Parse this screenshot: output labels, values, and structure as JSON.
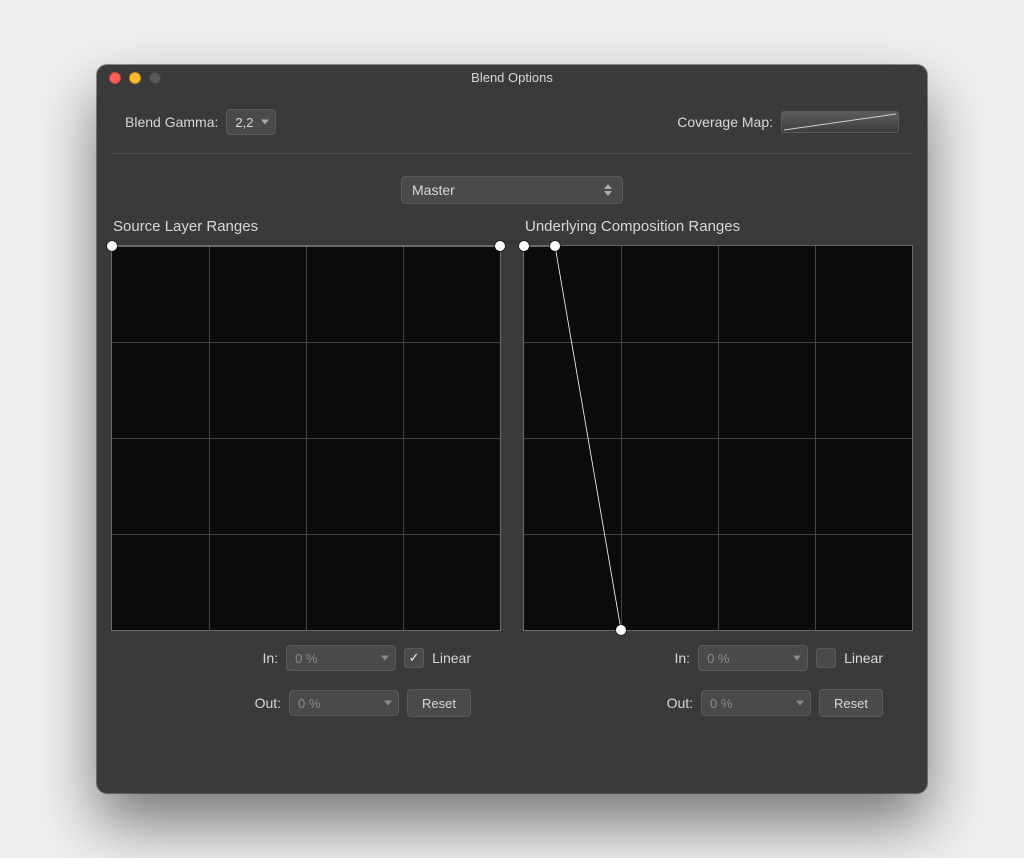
{
  "window": {
    "title": "Blend Options"
  },
  "header": {
    "blend_gamma_label": "Blend Gamma:",
    "blend_gamma_value": "2,2",
    "coverage_map_label": "Coverage Map:"
  },
  "channel": {
    "selected": "Master"
  },
  "source": {
    "heading": "Source Layer Ranges",
    "in_label": "In:",
    "out_label": "Out:",
    "in_value": "0 %",
    "out_value": "0 %",
    "linear_label": "Linear",
    "linear_checked": true,
    "reset_label": "Reset"
  },
  "underlying": {
    "heading": "Underlying Composition Ranges",
    "in_label": "In:",
    "out_label": "Out:",
    "in_value": "0 %",
    "out_value": "0 %",
    "linear_label": "Linear",
    "linear_checked": false,
    "reset_label": "Reset"
  },
  "chart_data": [
    {
      "type": "line",
      "name": "source_layer_ranges",
      "xlabel": "",
      "ylabel": "",
      "xlim": [
        0,
        100
      ],
      "ylim": [
        0,
        100
      ],
      "points": [
        {
          "x": 0,
          "y": 100
        },
        {
          "x": 100,
          "y": 100
        }
      ]
    },
    {
      "type": "line",
      "name": "underlying_composition_ranges",
      "xlabel": "",
      "ylabel": "",
      "xlim": [
        0,
        100
      ],
      "ylim": [
        0,
        100
      ],
      "points": [
        {
          "x": 0,
          "y": 100
        },
        {
          "x": 8,
          "y": 100
        },
        {
          "x": 25,
          "y": 0
        }
      ]
    },
    {
      "type": "line",
      "name": "coverage_map_preview",
      "xlabel": "",
      "ylabel": "",
      "xlim": [
        0,
        100
      ],
      "ylim": [
        0,
        100
      ],
      "points": [
        {
          "x": 0,
          "y": 10
        },
        {
          "x": 100,
          "y": 90
        }
      ]
    }
  ]
}
